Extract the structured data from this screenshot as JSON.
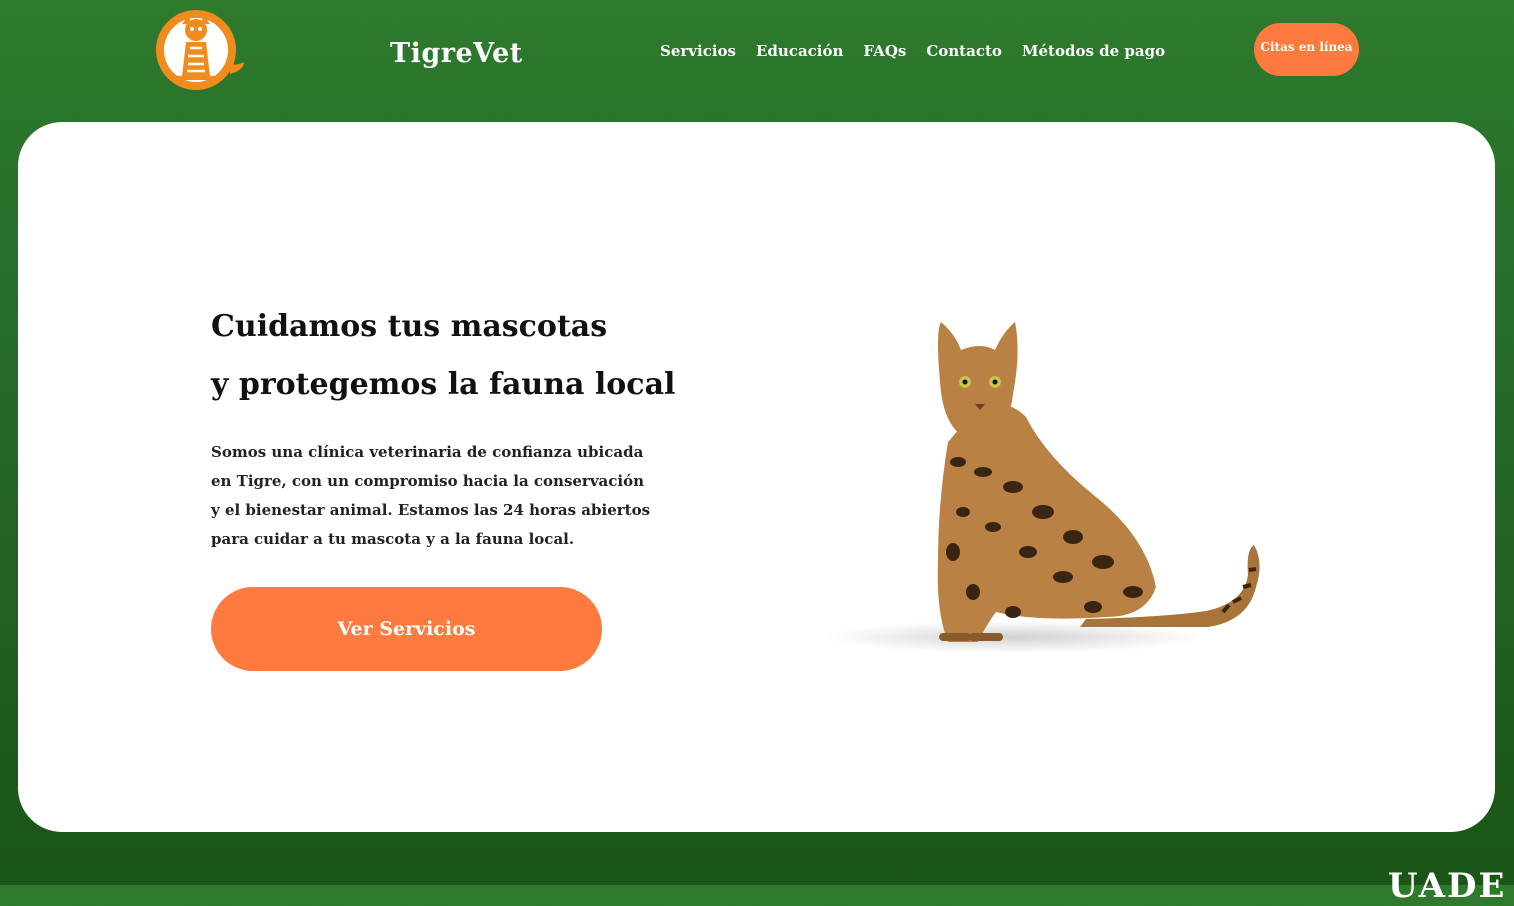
{
  "header": {
    "brand": "TigreVet",
    "nav": [
      "Servicios",
      "Educación",
      "FAQs",
      "Contacto",
      "Métodos de pago"
    ],
    "cta_label": "Citas en línea",
    "logo_icon": "tiger-logo-icon"
  },
  "hero": {
    "headline_line1": "Cuidamos tus mascotas",
    "headline_line2": "y protegemos la fauna local",
    "description": "Somos una clínica veterinaria de confianza ubicada en Tigre, con un compromiso hacia la conservación y el bienestar animal. Estamos las 24 horas abiertos para cuidar a tu mascota y a la fauna local.",
    "cta_label": "Ver Servicios",
    "image_icon": "bengal-cat-image"
  },
  "footer": {
    "text": "",
    "logo": "UADE"
  },
  "colors": {
    "accent": "#ff7a3f",
    "background": "#2e7a2c",
    "logo_orange": "#f08c1e"
  }
}
